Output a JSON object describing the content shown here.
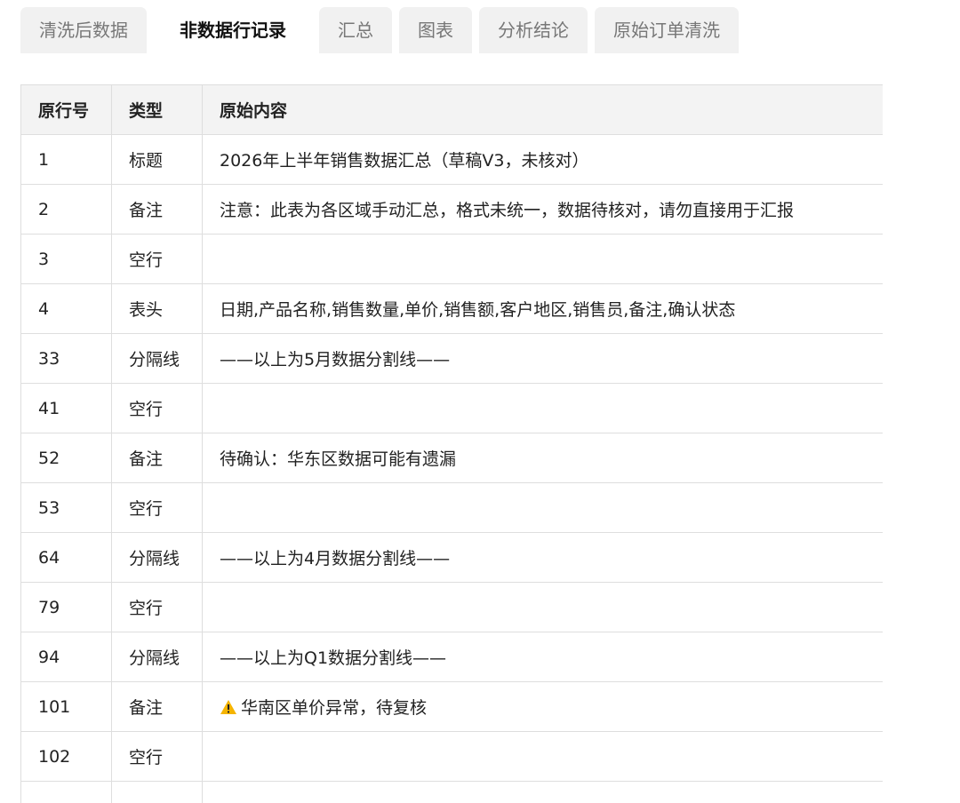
{
  "tabs": [
    {
      "label": "清洗后数据",
      "active": false
    },
    {
      "label": "非数据行记录",
      "active": true
    },
    {
      "label": "汇总",
      "active": false
    },
    {
      "label": "图表",
      "active": false
    },
    {
      "label": "分析结论",
      "active": false
    },
    {
      "label": "原始订单清洗",
      "active": false
    }
  ],
  "table": {
    "headers": [
      "原行号",
      "类型",
      "原始内容"
    ],
    "rows": [
      {
        "line": "1",
        "type": "标题",
        "content": "2026年上半年销售数据汇总（草稿V3，未核对）"
      },
      {
        "line": "2",
        "type": "备注",
        "content": "注意：此表为各区域手动汇总，格式未统一，数据待核对，请勿直接用于汇报"
      },
      {
        "line": "3",
        "type": "空行",
        "content": ""
      },
      {
        "line": "4",
        "type": "表头",
        "content": "日期,产品名称,销售数量,单价,销售额,客户地区,销售员,备注,确认状态"
      },
      {
        "line": "33",
        "type": "分隔线",
        "content": "——以上为5月数据分割线——"
      },
      {
        "line": "41",
        "type": "空行",
        "content": ""
      },
      {
        "line": "52",
        "type": "备注",
        "content": "待确认：华东区数据可能有遗漏"
      },
      {
        "line": "53",
        "type": "空行",
        "content": ""
      },
      {
        "line": "64",
        "type": "分隔线",
        "content": "——以上为4月数据分割线——"
      },
      {
        "line": "79",
        "type": "空行",
        "content": ""
      },
      {
        "line": "94",
        "type": "分隔线",
        "content": "——以上为Q1数据分割线——"
      },
      {
        "line": "101",
        "type": "备注",
        "content": "华南区单价异常，待复核",
        "icon": "warning-icon"
      },
      {
        "line": "102",
        "type": "空行",
        "content": ""
      },
      {
        "line": "",
        "type": "",
        "content": ""
      }
    ]
  },
  "colors": {
    "warning": "#f5b400",
    "header_bg": "#f3f3f3",
    "tab_bg": "#f1f1f1",
    "border": "#dedede"
  }
}
